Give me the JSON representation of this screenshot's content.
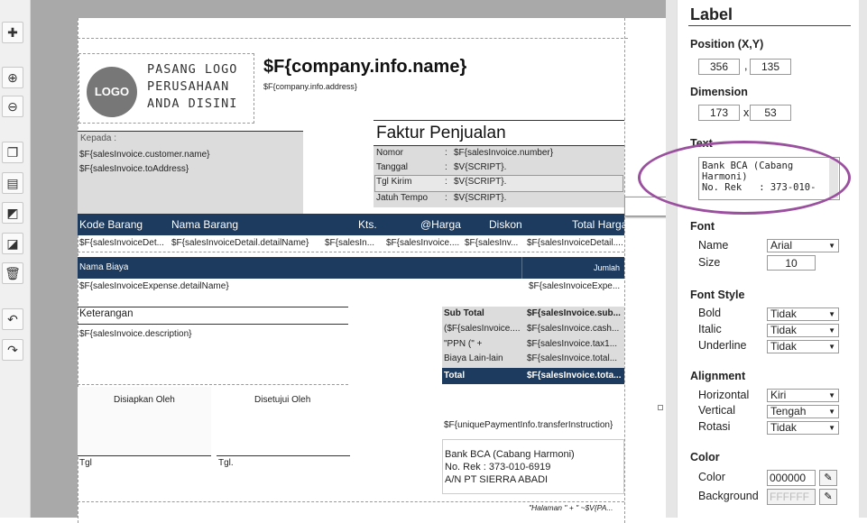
{
  "toolbar": {
    "icons": [
      "plus-icon",
      "zoom-in-icon",
      "zoom-out-icon",
      "copy-icon",
      "paste-icon",
      "bring-front-icon",
      "send-back-icon",
      "delete-icon",
      "undo-icon",
      "redo-icon"
    ]
  },
  "report": {
    "logo_badge": "LOGO",
    "logo_text_1": "PASANG LOGO",
    "logo_text_2": "PERUSAHAAN",
    "logo_text_3": "ANDA DISINI",
    "company_name": "$F{company.info.name}",
    "company_address": "$F{company.info.address}",
    "kepada": "Kepada :",
    "customer_name": "$F{salesInvoice.customer.name}",
    "to_address": "$F{salesInvoice.toAddress}",
    "faktur_title": "Faktur Penjualan",
    "info": [
      {
        "label": "Nomor",
        "sep": ":",
        "value": "$F{salesInvoice.number}"
      },
      {
        "label": "Tanggal",
        "sep": ":",
        "value": "$V{SCRIPT}."
      },
      {
        "label": "Tgl Kirim",
        "sep": ":",
        "value": "$V{SCRIPT}."
      },
      {
        "label": "Jatuh Tempo",
        "sep": ":",
        "value": "$V{SCRIPT}."
      }
    ],
    "detail_headers": {
      "kode": "Kode Barang",
      "nama": "Nama Barang",
      "kts": "Kts.",
      "harga": "@Harga",
      "diskon": "Diskon",
      "total": "Total Harga"
    },
    "detail_row": {
      "kode": "$F{salesInvoiceDet...",
      "nama": "$F{salesInvoiceDetail.detailName}",
      "kts": "$F{salesIn...",
      "harga": "$F{salesInvoice....",
      "diskon": "$F{salesInv...",
      "total": "$F{salesInvoiceDetail...."
    },
    "expense_headers": {
      "nama": "Nama Biaya",
      "jumlah": "Jumlah"
    },
    "expense_row": {
      "nama": "$F{salesInvoiceExpense.detailName}",
      "jumlah": "$F{salesInvoiceExpe..."
    },
    "keterangan": "Keterangan",
    "description": "$F{salesInvoice.description}",
    "totals": [
      {
        "label": "Sub Total",
        "value": "$F{salesInvoice.sub..."
      },
      {
        "label": "($F{salesInvoice....",
        "value": "$F{salesInvoice.cash..."
      },
      {
        "label": "\"PPN (\" +",
        "value": "$F{salesInvoice.tax1..."
      },
      {
        "label": "Biaya Lain-lain",
        "value": "$F{salesInvoice.total..."
      }
    ],
    "total_label": "Total",
    "total_value": "$F{salesInvoice.tota...",
    "disiapkan": "Disiapkan Oleh",
    "disetujui": "Disetujui Oleh",
    "tgl1": "Tgl",
    "tgl2": "Tgl.",
    "transfer": "$F{uniquePaymentInfo.transferInstruction}",
    "bank_1": "Bank BCA (Cabang Harmoni)",
    "bank_2": "No. Rek   : 373-010-6919",
    "bank_3": "A/N PT SIERRA ABADI",
    "footer": "\"Halaman \" + \" ~$V{PA..."
  },
  "panel": {
    "title": "Label",
    "position_label": "Position (X,Y)",
    "pos_x": "356",
    "pos_sep": ",",
    "pos_y": "135",
    "dimension_label": "Dimension",
    "dim_w": "173",
    "dim_sep": "x",
    "dim_h": "53",
    "text_label": "Text",
    "text_value": "Bank BCA (Cabang\nHarmoni)\nNo. Rek   : 373-010-",
    "font_label": "Font",
    "name_label": "Name",
    "name_value": "Arial",
    "size_label": "Size",
    "size_value": "10",
    "fontstyle_label": "Font Style",
    "bold_label": "Bold",
    "bold_value": "Tidak",
    "italic_label": "Italic",
    "italic_value": "Tidak",
    "underline_label": "Underline",
    "underline_value": "Tidak",
    "alignment_label": "Alignment",
    "horizontal_label": "Horizontal",
    "horizontal_value": "Kiri",
    "vertical_label": "Vertical",
    "vertical_value": "Tengah",
    "rotasi_label": "Rotasi",
    "rotasi_value": "Tidak",
    "color_label": "Color",
    "color_field_label": "Color",
    "color_value": "000000",
    "background_label": "Background",
    "background_value": "FFFFFF"
  },
  "colors": {
    "accent_highlight": "#9b4f9f",
    "header_navy": "#1c3b5e"
  }
}
